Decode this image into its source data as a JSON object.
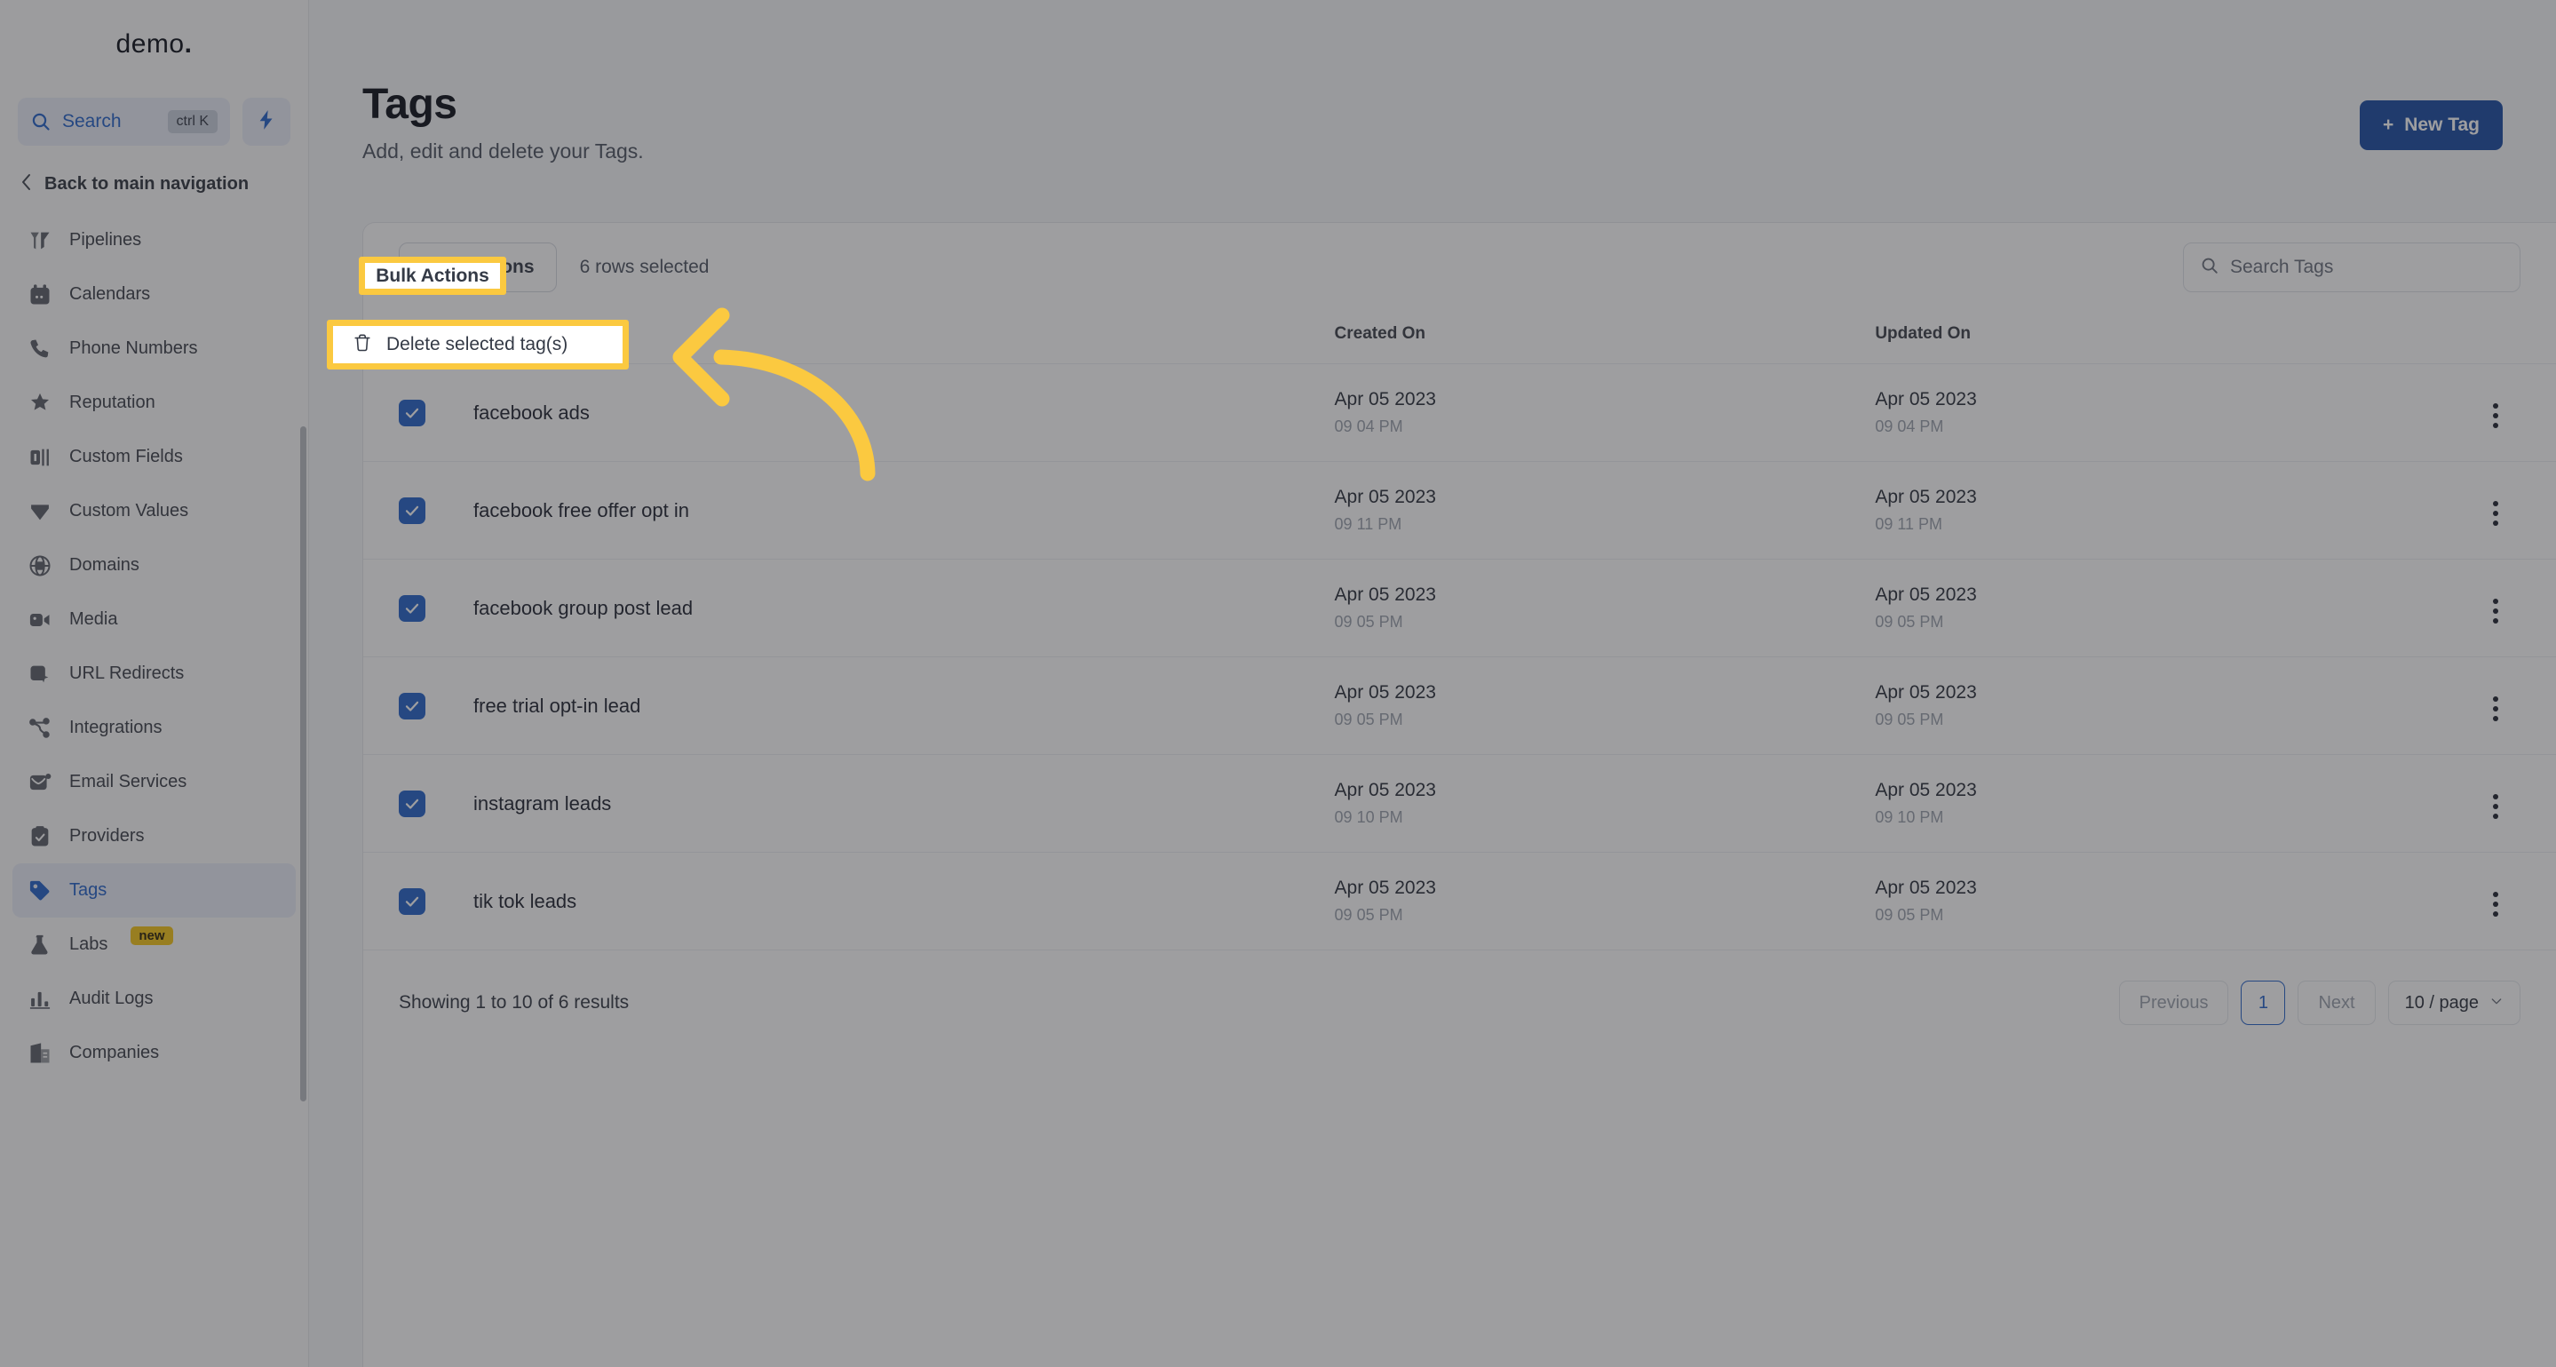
{
  "sidebar": {
    "brand": "demo",
    "brand_dot": ".",
    "search": {
      "label": "Search",
      "shortcut": "ctrl K",
      "icon": "search-icon"
    },
    "quick_action_icon": "bolt-icon",
    "back_label": "Back to main navigation",
    "items": [
      {
        "label": "Pipelines",
        "icon": "pipelines-icon",
        "active": false
      },
      {
        "label": "Calendars",
        "icon": "calendar-icon",
        "active": false
      },
      {
        "label": "Phone Numbers",
        "icon": "phone-icon",
        "active": false
      },
      {
        "label": "Reputation",
        "icon": "star-icon",
        "active": false
      },
      {
        "label": "Custom Fields",
        "icon": "custom-fields-icon",
        "active": false
      },
      {
        "label": "Custom Values",
        "icon": "diamond-icon",
        "active": false
      },
      {
        "label": "Domains",
        "icon": "globe-icon",
        "active": false
      },
      {
        "label": "Media",
        "icon": "media-icon",
        "active": false
      },
      {
        "label": "URL Redirects",
        "icon": "redirect-icon",
        "active": false
      },
      {
        "label": "Integrations",
        "icon": "integrations-icon",
        "active": false
      },
      {
        "label": "Email Services",
        "icon": "email-icon",
        "active": false
      },
      {
        "label": "Providers",
        "icon": "clipboard-icon",
        "active": false
      },
      {
        "label": "Tags",
        "icon": "tag-icon",
        "active": true
      },
      {
        "label": "Labs",
        "icon": "flask-icon",
        "active": false,
        "badge": "new"
      },
      {
        "label": "Audit Logs",
        "icon": "chart-icon",
        "active": false
      },
      {
        "label": "Companies",
        "icon": "building-icon",
        "active": false
      }
    ]
  },
  "header": {
    "title": "Tags",
    "subtitle": "Add, edit and delete your Tags.",
    "new_tag_label": "New Tag",
    "new_tag_plus": "+"
  },
  "toolbar": {
    "bulk_actions_label": "Bulk Actions",
    "rows_selected": "6 rows selected",
    "search_placeholder": "Search Tags"
  },
  "dropdown": {
    "open": true,
    "items": [
      {
        "label": "Delete selected tag(s)",
        "icon": "trash-icon"
      }
    ]
  },
  "table": {
    "columns": [
      "",
      "",
      "Created On",
      "Updated On",
      ""
    ],
    "rows": [
      {
        "checked": true,
        "name": "facebook ads",
        "created_date": "Apr 05 2023",
        "created_time": "09 04 PM",
        "updated_date": "Apr 05 2023",
        "updated_time": "09 04 PM"
      },
      {
        "checked": true,
        "name": "facebook free offer opt in",
        "created_date": "Apr 05 2023",
        "created_time": "09 11 PM",
        "updated_date": "Apr 05 2023",
        "updated_time": "09 11 PM"
      },
      {
        "checked": true,
        "name": "facebook group post lead",
        "created_date": "Apr 05 2023",
        "created_time": "09 05 PM",
        "updated_date": "Apr 05 2023",
        "updated_time": "09 05 PM"
      },
      {
        "checked": true,
        "name": "free trial opt-in lead",
        "created_date": "Apr 05 2023",
        "created_time": "09 05 PM",
        "updated_date": "Apr 05 2023",
        "updated_time": "09 05 PM"
      },
      {
        "checked": true,
        "name": "instagram leads",
        "created_date": "Apr 05 2023",
        "created_time": "09 10 PM",
        "updated_date": "Apr 05 2023",
        "updated_time": "09 10 PM"
      },
      {
        "checked": true,
        "name": "tik tok leads",
        "created_date": "Apr 05 2023",
        "created_time": "09 05 PM",
        "updated_date": "Apr 05 2023",
        "updated_time": "09 05 PM"
      }
    ]
  },
  "footer": {
    "showing": "Showing 1 to 10 of 6 results",
    "previous": "Previous",
    "page": "1",
    "next": "Next",
    "per_page": "10 / page"
  },
  "annotation": {
    "highlight_color": "#fbc940",
    "arrow": "curved-left-arrow"
  },
  "colors": {
    "accent": "#2563c9",
    "primary_button": "#1b4ba3",
    "highlight": "#fbc940",
    "badge": "#f5c518"
  }
}
